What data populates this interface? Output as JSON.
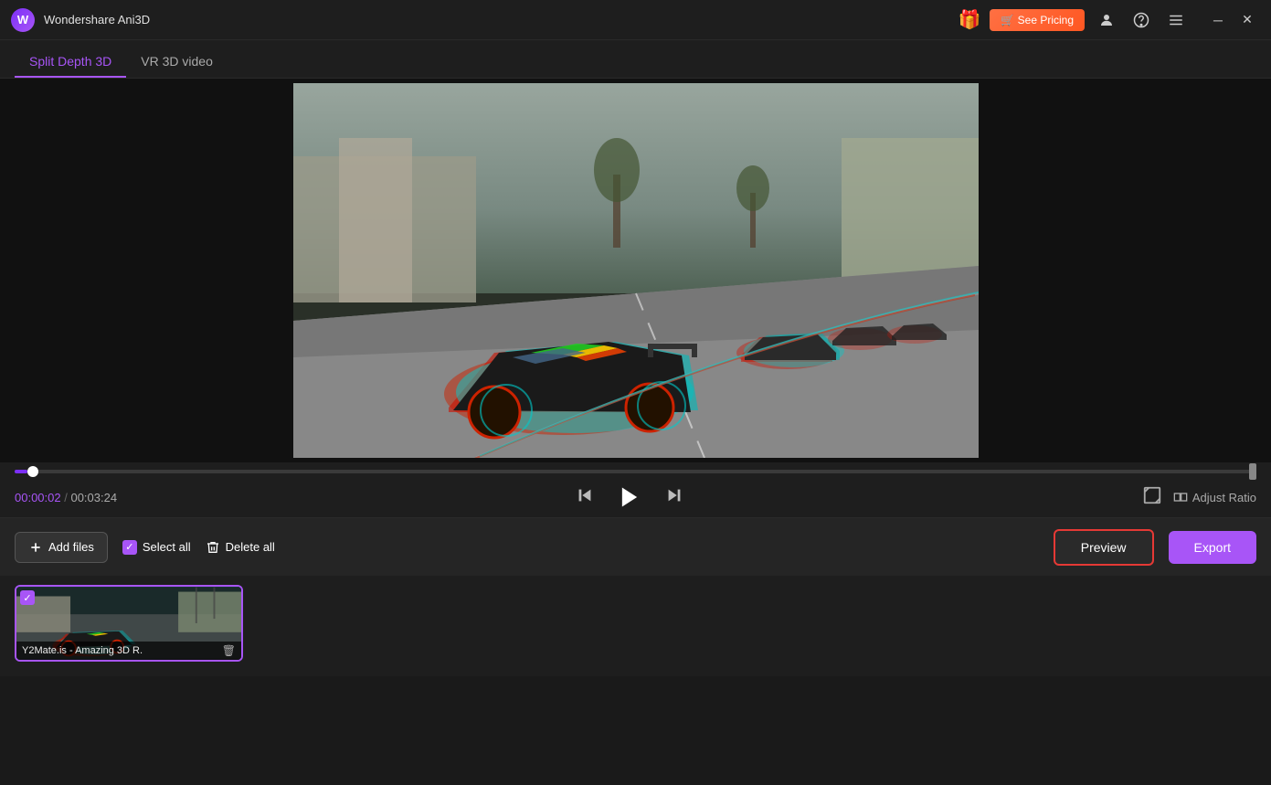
{
  "app": {
    "title": "Wondershare Ani3D",
    "logo_text": "W"
  },
  "header": {
    "gift_icon": "🎁",
    "see_pricing_label": "🛒 See Pricing",
    "user_icon": "👤",
    "headset_icon": "🎧",
    "menu_icon": "≡",
    "minimize_icon": "─",
    "close_icon": "✕"
  },
  "tabs": [
    {
      "id": "split-depth-3d",
      "label": "Split Depth 3D",
      "active": true
    },
    {
      "id": "vr-3d-video",
      "label": "VR 3D video",
      "active": false
    }
  ],
  "playback": {
    "current_time": "00:00:02",
    "total_time": "00:03:24",
    "time_separator": "/",
    "skip_back_icon": "⏮",
    "play_icon": "▶",
    "skip_forward_icon": "⏭",
    "aspect_icon": "⛶",
    "adjust_ratio_label": "Adjust Ratio",
    "seek_progress_percent": 1
  },
  "toolbar": {
    "add_files_label": "Add files",
    "select_all_label": "Select all",
    "delete_all_label": "Delete all",
    "preview_label": "Preview",
    "export_label": "Export"
  },
  "thumbnails": [
    {
      "id": "thumb-1",
      "filename": "Y2Mate.is - Amazing 3D R.",
      "checked": true,
      "delete_icon": "🗑"
    }
  ]
}
